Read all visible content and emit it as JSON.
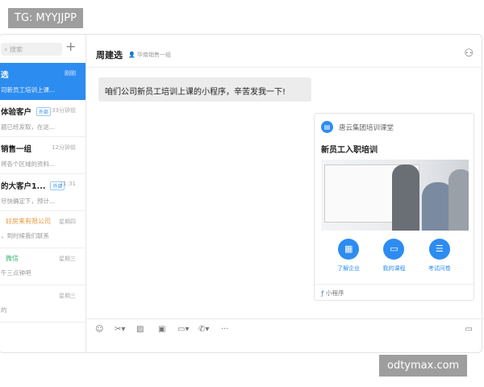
{
  "watermarks": {
    "top": "TG: MYYJJPP",
    "bottom": "odtymax.com"
  },
  "sidebar": {
    "search_placeholder": "搜索",
    "items": [
      {
        "name": "选",
        "time": "刚刚",
        "preview": "司新员工培训上课..."
      },
      {
        "name": "体验客户",
        "badge": "外部",
        "time": "33分钟前",
        "preview": "题已经发取，在这..."
      },
      {
        "name": "销售一组",
        "time": "12分钟前",
        "preview": "将各个区域的资料..."
      },
      {
        "name": "的大客户1...",
        "badge": "外部",
        "time": "11:31",
        "preview": "尽快确定下，预计..."
      },
      {
        "name": "好房来有限公司",
        "time": "星期四",
        "preview": "，到时候我们联系"
      },
      {
        "name": "微信",
        "time": "星期三",
        "preview": "午三点钟吧"
      },
      {
        "name": "",
        "time": "星期三",
        "preview": "的"
      }
    ]
  },
  "header": {
    "title": "周建选",
    "dept": "华南销售一组"
  },
  "message": "咱们公司新员工培训上课的小程序，辛苦发我一下!",
  "card": {
    "org": "唐云集团培训课堂",
    "title": "新员工入职培训",
    "actions": [
      "了解企业",
      "我的课程",
      "考试问卷"
    ],
    "footer": "小程序"
  }
}
